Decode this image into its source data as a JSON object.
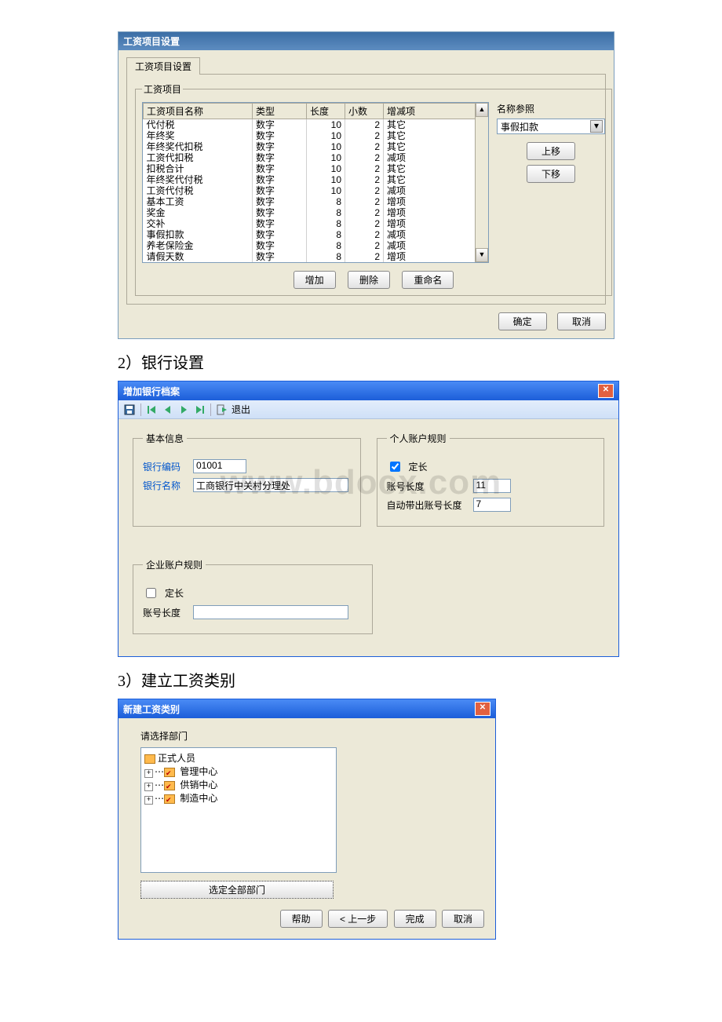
{
  "watermark": "www.bdocx.com",
  "dialog1": {
    "title": "工资项目设置",
    "tab": "工资项目设置",
    "fieldset_legend": "工资项目",
    "columns": {
      "name": "工资项目名称",
      "type": "类型",
      "length": "长度",
      "decimal": "小数",
      "incdec": "增减项"
    },
    "rows": [
      {
        "name": "代付税",
        "type": "数字",
        "len": "10",
        "dec": "2",
        "inc": "其它"
      },
      {
        "name": "年终奖",
        "type": "数字",
        "len": "10",
        "dec": "2",
        "inc": "其它"
      },
      {
        "name": "年终奖代扣税",
        "type": "数字",
        "len": "10",
        "dec": "2",
        "inc": "其它"
      },
      {
        "name": "工资代扣税",
        "type": "数字",
        "len": "10",
        "dec": "2",
        "inc": "减项"
      },
      {
        "name": "扣税合计",
        "type": "数字",
        "len": "10",
        "dec": "2",
        "inc": "其它"
      },
      {
        "name": "年终奖代付税",
        "type": "数字",
        "len": "10",
        "dec": "2",
        "inc": "其它"
      },
      {
        "name": "工资代付税",
        "type": "数字",
        "len": "10",
        "dec": "2",
        "inc": "减项"
      },
      {
        "name": "基本工资",
        "type": "数字",
        "len": "8",
        "dec": "2",
        "inc": "增项"
      },
      {
        "name": "奖金",
        "type": "数字",
        "len": "8",
        "dec": "2",
        "inc": "增项"
      },
      {
        "name": "交补",
        "type": "数字",
        "len": "8",
        "dec": "2",
        "inc": "增项"
      },
      {
        "name": "事假扣款",
        "type": "数字",
        "len": "8",
        "dec": "2",
        "inc": "减项"
      },
      {
        "name": "养老保险金",
        "type": "数字",
        "len": "8",
        "dec": "2",
        "inc": "减项"
      },
      {
        "name": "请假天数",
        "type": "数字",
        "len": "8",
        "dec": "2",
        "inc": "增项"
      }
    ],
    "name_ref_label": "名称参照",
    "name_ref_value": "事假扣款",
    "btn_up": "上移",
    "btn_down": "下移",
    "btn_add": "增加",
    "btn_delete": "删除",
    "btn_rename": "重命名",
    "btn_ok": "确定",
    "btn_cancel": "取消"
  },
  "heading2": "2）银行设置",
  "dialog2": {
    "title": "增加银行档案",
    "exit_label": "退出",
    "basic_legend": "基本信息",
    "code_label": "银行编码",
    "code_value": "01001",
    "name_label": "银行名称",
    "name_value": "工商银行中关村分理处",
    "personal_legend": "个人账户规则",
    "fixed_label": "定长",
    "personal_fixed_checked": true,
    "acctlen_label": "账号长度",
    "acctlen_value": "11",
    "autolen_label": "自动带出账号长度",
    "autolen_value": "7",
    "corp_legend": "企业账户规则",
    "corp_fixed_checked": false,
    "corp_acctlen_value": ""
  },
  "heading3": "3）建立工资类别",
  "dialog3": {
    "title": "新建工资类别",
    "prompt": "请选择部门",
    "root": "正式人员",
    "items": [
      "管理中心",
      "供销中心",
      "制造中心"
    ],
    "all_button": "选定全部部门",
    "btn_help": "帮助",
    "btn_prev": "< 上一步",
    "btn_finish": "完成",
    "btn_cancel": "取消"
  }
}
